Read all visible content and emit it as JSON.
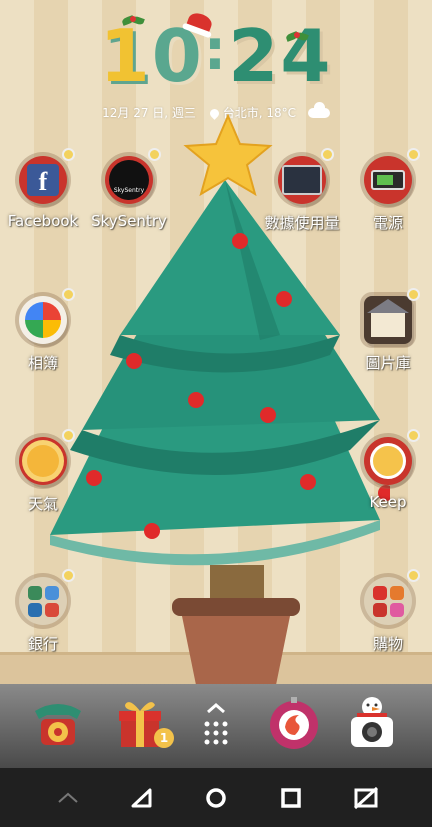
{
  "clock": {
    "h1": "1",
    "h2": "0",
    "colon": ":",
    "m1": "2",
    "m2": "4"
  },
  "status_line": {
    "date": "12月 27 日, 週三",
    "location": "台北市, 18°C"
  },
  "apps": {
    "facebook": "Facebook",
    "skysentry": "SkySentry",
    "skysentry_logo": "SkySentry",
    "data_usage": "數據使用量",
    "power": "電源",
    "photos": "相簿",
    "gallery": "圖片庫",
    "weather": "天氣",
    "keep": "Keep",
    "bank": "銀行",
    "shopping": "購物"
  },
  "dock": {
    "gift_badge": "1"
  },
  "colors": {
    "tree": "#2a9a80",
    "tree_dark": "#1f7d68",
    "ornament": "#e02a2a",
    "star": "#f6c33b",
    "pot": "#a9664a"
  }
}
